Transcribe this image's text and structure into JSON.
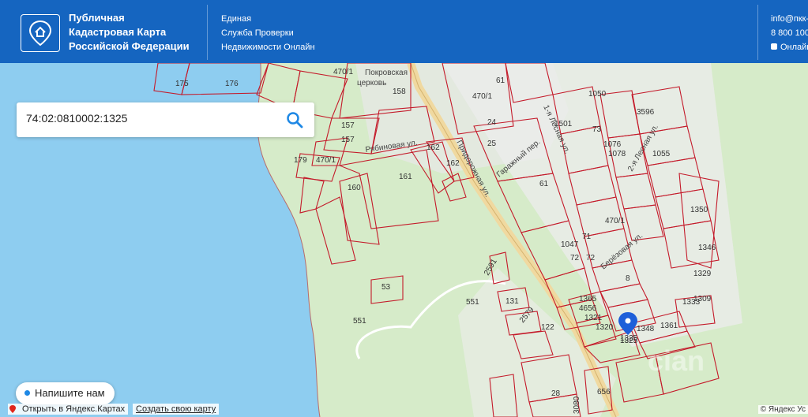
{
  "header": {
    "brand": [
      "Публичная",
      "Кадастровая Карта",
      "Российской Федерации"
    ],
    "service": [
      "Единая",
      "Служба Проверки",
      "Недвижимости Онлайн"
    ],
    "email": "info@пкк-",
    "phone": "8 800 100",
    "online": "Онлайн"
  },
  "search": {
    "value": "74:02:0810002:1325"
  },
  "map": {
    "streets": [
      "Покровская",
      "церковь",
      "Рябиновая ул.",
      "Придорожная ул.",
      "Гаражный пер.",
      "1-я Лесная ул.",
      "Берёзовая ул.",
      "2-я Лесная ул."
    ],
    "parcels": [
      "175",
      "176",
      "470/1",
      "158",
      "61",
      "470/1",
      "157",
      "157",
      "179",
      "470/1",
      "162",
      "162",
      "161",
      "160",
      "24",
      "25",
      "61",
      "1501",
      "1050",
      "73",
      "1076",
      "3596",
      "1078",
      "1055",
      "1350",
      "1346",
      "470/1",
      "1047",
      "71",
      "72",
      "72",
      "551",
      "551",
      "53",
      "2591",
      "131",
      "2579",
      "122",
      "1365",
      "4656",
      "1321",
      "1320",
      "1325",
      "1348",
      "1333",
      "1329",
      "8",
      "1309",
      "28",
      "656",
      "3080",
      "1361"
    ],
    "watermark": "cian",
    "pin_label": "1325"
  },
  "chat": {
    "label": "Напишите нам"
  },
  "yandex": {
    "open_label": "Открыть в Яндекс.Картах",
    "create_label": "Создать свою карту",
    "copyright": "© Яндекс Ус"
  }
}
